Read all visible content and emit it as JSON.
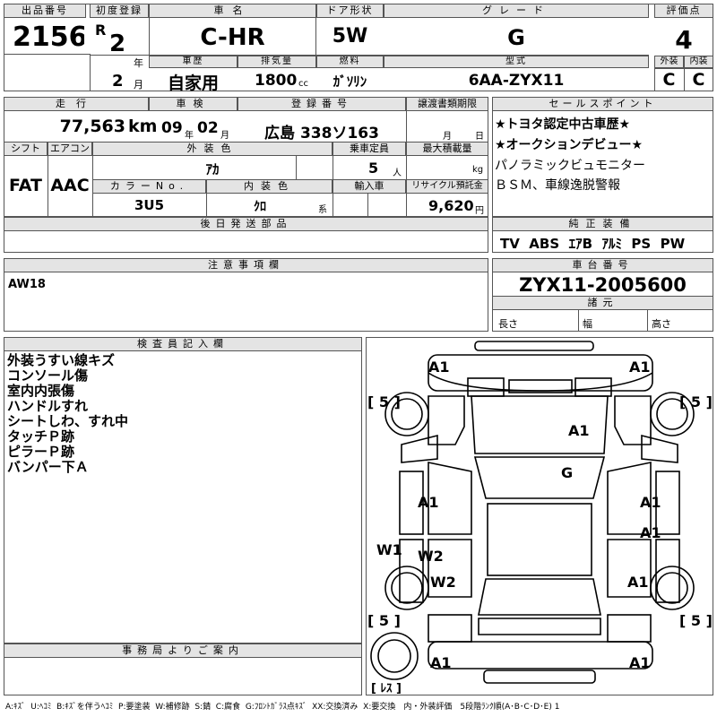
{
  "header": {
    "lot_label": "出品番号",
    "lot_no": "2156",
    "first_reg_label": "初度登録",
    "era": "R",
    "year": "2",
    "year_unit": "年",
    "month": "2",
    "month_unit": "月",
    "car_name_label": "車名",
    "car_name": "C-HR",
    "door_label": "ドア形状",
    "door": "5W",
    "grade_label": "グレード",
    "grade": "G",
    "score_label": "評価点",
    "score": "4",
    "history_label": "車歴",
    "history": "自家用",
    "displacement_label": "排気量",
    "displacement": "1800",
    "displacement_unit": "cc",
    "fuel_label": "燃料",
    "fuel": "ｶﾞｿﾘﾝ",
    "model_label": "型式",
    "model": "6AA-ZYX11",
    "exterior_label": "外装",
    "exterior": "C",
    "interior_label": "内装",
    "interior": "C"
  },
  "row2": {
    "mileage_label": "走行",
    "mileage": "77,563",
    "mileage_unit": "km",
    "inspection_label": "車検",
    "insp_year": "09",
    "insp_year_unit": "年",
    "insp_month": "02",
    "insp_month_unit": "月",
    "plate_label": "登録番号",
    "plate": "広島 338ソ163",
    "transfer_label": "譲渡書類期限",
    "transfer_month_unit": "月",
    "transfer_day_unit": "日",
    "shift_label": "シフト",
    "shift": "FAT",
    "ac_label": "エアコン",
    "ac": "AAC",
    "ext_color_label": "外装色",
    "ext_color": "ｱｶ",
    "capacity_label": "乗車定員",
    "capacity": "5",
    "capacity_unit": "人",
    "load_label": "最大積載量",
    "load_unit": "kg",
    "color_no_label": "カラーNo.",
    "color_no": "3U5",
    "int_color_label": "内装色",
    "int_color": "ｸﾛ",
    "int_color_unit": "系",
    "import_label": "輸入車",
    "recycle_label": "リサイクル預託金",
    "recycle": "9,620",
    "recycle_unit": "円",
    "later_parts_label": "後日発送部品"
  },
  "sales_points": {
    "label": "セールスポイント",
    "lines": [
      "★トヨタ認定中古車歴★",
      "★オークションデビュー★",
      "パノラミックビュモニター",
      "ＢＳＭ、車線逸脱警報"
    ]
  },
  "equipment": {
    "label": "純正装備",
    "text": "TV  ABS  ｴｱB  ｱﾙﾐ  PS  PW"
  },
  "caution": {
    "label": "注意事項欄",
    "text": "AW18"
  },
  "chassis": {
    "label": "車台番号",
    "number": "ZYX11-2005600",
    "specs_label": "諸元",
    "length_label": "長さ",
    "width_label": "幅",
    "height_label": "高さ"
  },
  "inspector": {
    "label": "検査員記入欄",
    "lines": [
      "外装うすい線キズ",
      "コンソール傷",
      "室内内張傷",
      "ハンドルすれ",
      "シートしわ、すれ中",
      "タッチＰ跡",
      "ピラーＰ跡",
      "バンパー下Ａ"
    ]
  },
  "office": {
    "label": "事務局よりご案内"
  },
  "diagram": {
    "marks": [
      {
        "text": "A1",
        "id": "front-left"
      },
      {
        "text": "A1",
        "id": "front-right"
      },
      {
        "text": "[ 5 ]",
        "id": "tire-fl"
      },
      {
        "text": "[ 5 ]",
        "id": "tire-fr"
      },
      {
        "text": "A1",
        "id": "hood"
      },
      {
        "text": "G",
        "id": "windshield"
      },
      {
        "text": "A1",
        "id": "left-front-door"
      },
      {
        "text": "A1",
        "id": "right-front-door"
      },
      {
        "text": "A1",
        "id": "right-rear-door"
      },
      {
        "text": "W1",
        "id": "left-sill"
      },
      {
        "text": "W2",
        "id": "left-rear-door"
      },
      {
        "text": "W2",
        "id": "left-rear-fender"
      },
      {
        "text": "A1",
        "id": "right-rear-fender"
      },
      {
        "text": "[ 5 ]",
        "id": "tire-rl"
      },
      {
        "text": "[ 5 ]",
        "id": "tire-rr"
      },
      {
        "text": "A1",
        "id": "rear-left"
      },
      {
        "text": "A1",
        "id": "rear-right"
      },
      {
        "text": "[ ﾚｽ ]",
        "id": "spare"
      }
    ]
  },
  "legend": {
    "text": "A:ｷｽﾞ  U:ﾍｺﾐ  B:ｷｽﾞを伴うﾍｺﾐ  P:要塗装  W:補修跡  S:錆  C:腐食  G:ﾌﾛﾝﾄｶﾞﾗｽ点ｷｽﾞ  XX:交換済み  X:要交換　内・外装評価　5段階ﾗﾝｸ順(A･B･C･D･E) 1"
  }
}
